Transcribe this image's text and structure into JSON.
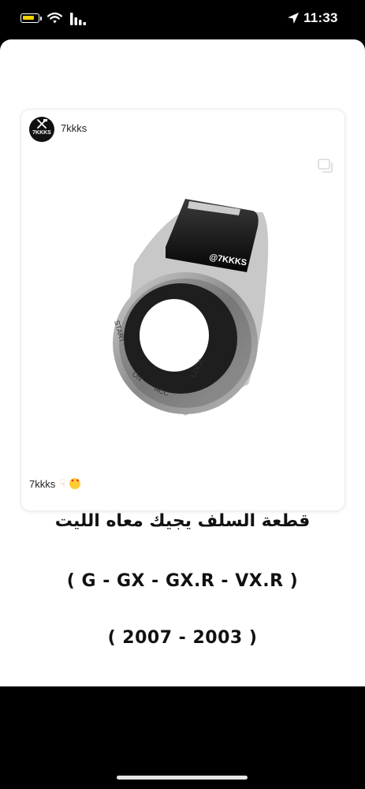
{
  "status_bar": {
    "time": "11:33",
    "battery_color": "#f5d200",
    "icons": [
      "battery-icon",
      "wifi-icon",
      "signal-icon",
      "location-icon"
    ]
  },
  "post": {
    "username": "7kkks",
    "avatar_text": "7KKKS",
    "caption_user": "7kkks",
    "caption_emojis": [
      "point-down-emoji",
      "heart-eyes-emoji"
    ],
    "image_watermark": "@7KKKS",
    "key_positions": [
      "START",
      "ON",
      "ACC",
      "LOCK"
    ]
  },
  "content": {
    "title": "قطعة السلف يجيك معاه الليت",
    "models": "( G - GX - GX.R - VX.R )",
    "years": "( 2007 - 2003 )"
  }
}
